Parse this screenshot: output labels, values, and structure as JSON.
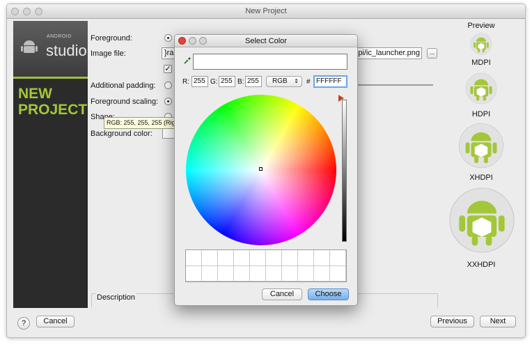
{
  "window": {
    "title": "New Project"
  },
  "brand": {
    "android_small": "ANDROID",
    "studio": "studio",
    "new_project": "NEW\nPROJECT"
  },
  "form": {
    "foreground_label": "Foreground:",
    "image_file_label": "Image file:",
    "image_file_value_left": "}rac",
    "image_file_value_right": "pi/ic_launcher.png",
    "browse_label": "...",
    "padding_label": "Additional padding:",
    "scaling_label": "Foreground scaling:",
    "shape_label": "Shape:",
    "background_color_label": "Background color:",
    "description_label": "Description"
  },
  "tooltip": {
    "text": "RGB: 255, 255, 255 (Righ"
  },
  "preview": {
    "title": "Preview",
    "sizes": [
      "MDPI",
      "HDPI",
      "XHDPI",
      "XXHDPI"
    ]
  },
  "buttons": {
    "help": "?",
    "cancel": "Cancel",
    "previous": "Previous",
    "next": "Next"
  },
  "dialog": {
    "title": "Select Color",
    "hex_input": "",
    "r_label": "R:",
    "r_value": "255",
    "g_label": "G:",
    "g_value": "255",
    "b_label": "B:",
    "b_value": "255",
    "mode": "RGB",
    "hash": "#",
    "hex_value": "FFFFFF",
    "cancel": "Cancel",
    "choose": "Choose"
  },
  "colors": {
    "android_green": "#a4c639",
    "accent_blue": "#5a9be0"
  }
}
